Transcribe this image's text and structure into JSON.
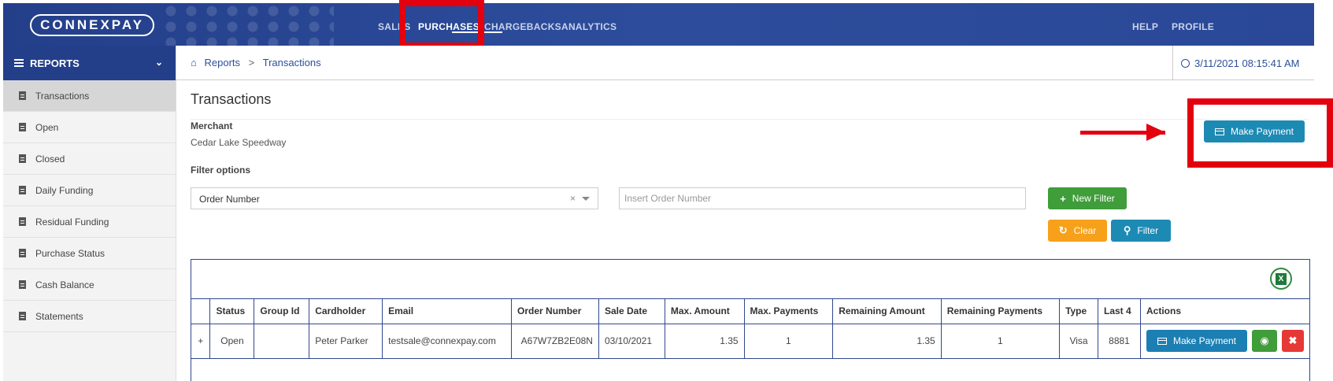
{
  "brand": {
    "logo_text": "CONNEXPAY"
  },
  "top_nav": {
    "items": [
      {
        "label": "SALES"
      },
      {
        "label": "PURCHASES"
      },
      {
        "label": "CHARGEBACKS"
      },
      {
        "label": "ANALYTICS"
      }
    ],
    "active": "PURCHASES",
    "right_items": [
      {
        "label": "HELP"
      },
      {
        "label": "PROFILE"
      }
    ]
  },
  "sidebar": {
    "header": "REPORTS",
    "items": [
      {
        "label": "Transactions",
        "active": true
      },
      {
        "label": "Open"
      },
      {
        "label": "Closed"
      },
      {
        "label": "Daily Funding"
      },
      {
        "label": "Residual Funding"
      },
      {
        "label": "Purchase Status"
      },
      {
        "label": "Cash Balance"
      },
      {
        "label": "Statements"
      }
    ]
  },
  "breadcrumb": {
    "root": "Reports",
    "separator": ">",
    "current": "Transactions"
  },
  "timestamp": "3/11/2021 08:15:41 AM",
  "page": {
    "title": "Transactions",
    "merchant_label": "Merchant",
    "merchant_value": "Cedar Lake Speedway",
    "filter_label": "Filter options",
    "make_payment": "Make Payment"
  },
  "filter": {
    "select_value": "Order Number",
    "clear_glyph": "×",
    "input_placeholder": "Insert Order Number",
    "new_filter": "New Filter",
    "clear": "Clear",
    "filter": "Filter"
  },
  "table": {
    "excel_glyph": "X",
    "columns": [
      "",
      "Status",
      "Group Id",
      "Cardholder",
      "Email",
      "Order Number",
      "Sale Date",
      "Max. Amount",
      "Max. Payments",
      "Remaining Amount",
      "Remaining Payments",
      "Type",
      "Last 4",
      "Actions"
    ],
    "rows": [
      {
        "expand": "+",
        "status": "Open",
        "group_id": "",
        "cardholder": "Peter Parker",
        "email": "testsale@connexpay.com",
        "order_number": "A67W7ZB2E08N",
        "sale_date": "03/10/2021",
        "max_amount": "1.35",
        "max_payments": "1",
        "remaining_amount": "1.35",
        "remaining_payments": "1",
        "type": "Visa",
        "last4": "8881",
        "action_label": "Make Payment"
      }
    ]
  },
  "colors": {
    "nav_blue": "#243f8a",
    "highlight_red": "#e3000f",
    "green": "#3f9d3a",
    "orange": "#f7a11b",
    "teal": "#1d8ab4",
    "danger": "#e53935"
  }
}
